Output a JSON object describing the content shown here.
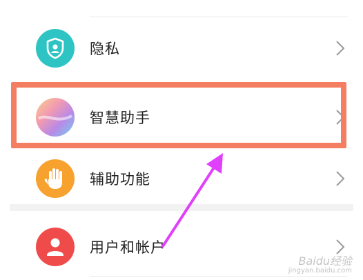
{
  "settings": {
    "items": [
      {
        "id": "privacy",
        "label": "隐私",
        "icon": "shield-person-icon",
        "color": "#2ec4c4"
      },
      {
        "id": "assistant",
        "label": "智慧助手",
        "icon": "gradient-orb-icon",
        "color": "#c58ae0"
      },
      {
        "id": "accessibility",
        "label": "辅助功能",
        "icon": "hand-icon",
        "color": "#f7a12f"
      },
      {
        "id": "accounts",
        "label": "用户和帐户",
        "icon": "user-icon",
        "color": "#f04b4b"
      }
    ]
  },
  "annotation": {
    "highlight_color": "#f37e62",
    "arrow_color": "#e040fb"
  },
  "watermark": {
    "brand": "Baidu经验",
    "site": "jingyan.baidu.com"
  }
}
